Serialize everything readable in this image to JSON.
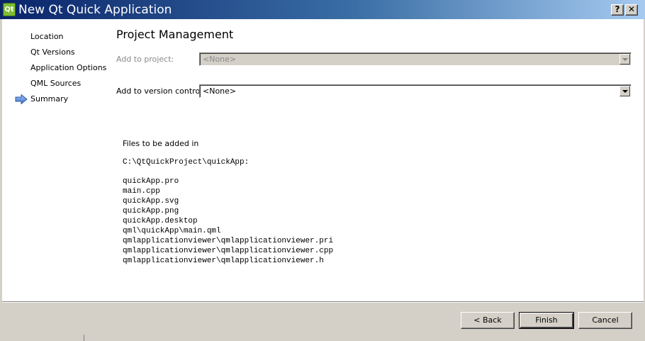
{
  "window": {
    "title": "New Qt Quick Application",
    "icon_text": "Qt",
    "help_label": "?",
    "close_label": "✕"
  },
  "sidebar": {
    "items": [
      {
        "label": "Location"
      },
      {
        "label": "Qt Versions"
      },
      {
        "label": "Application Options"
      },
      {
        "label": "QML Sources"
      },
      {
        "label": "Summary",
        "current": true
      }
    ],
    "current_icon": "arrow-right-icon"
  },
  "page": {
    "title": "Project Management",
    "add_to_project": {
      "label": "Add to project:",
      "value": "<None>",
      "enabled": false
    },
    "add_to_vcs": {
      "label": "Add to version control:",
      "value": "<None>",
      "enabled": true
    },
    "files": {
      "heading": "Files to be added in",
      "path": "C:\\QtQuickProject\\quickApp:",
      "list": [
        "quickApp.pro",
        "main.cpp",
        "quickApp.svg",
        "quickApp.png",
        "quickApp.desktop",
        "qml\\quickApp\\main.qml",
        "qmlapplicationviewer\\qmlapplicationviewer.pri",
        "qmlapplicationviewer\\qmlapplicationviewer.cpp",
        "qmlapplicationviewer\\qmlapplicationviewer.h"
      ]
    }
  },
  "buttons": {
    "back": "< Back",
    "finish": "Finish",
    "cancel": "Cancel"
  },
  "colors": {
    "titlebar_start": "#0a246a",
    "titlebar_end": "#a6caf0",
    "dialog_bg": "#d4d0c8",
    "arrow": "#5b8fd8"
  }
}
